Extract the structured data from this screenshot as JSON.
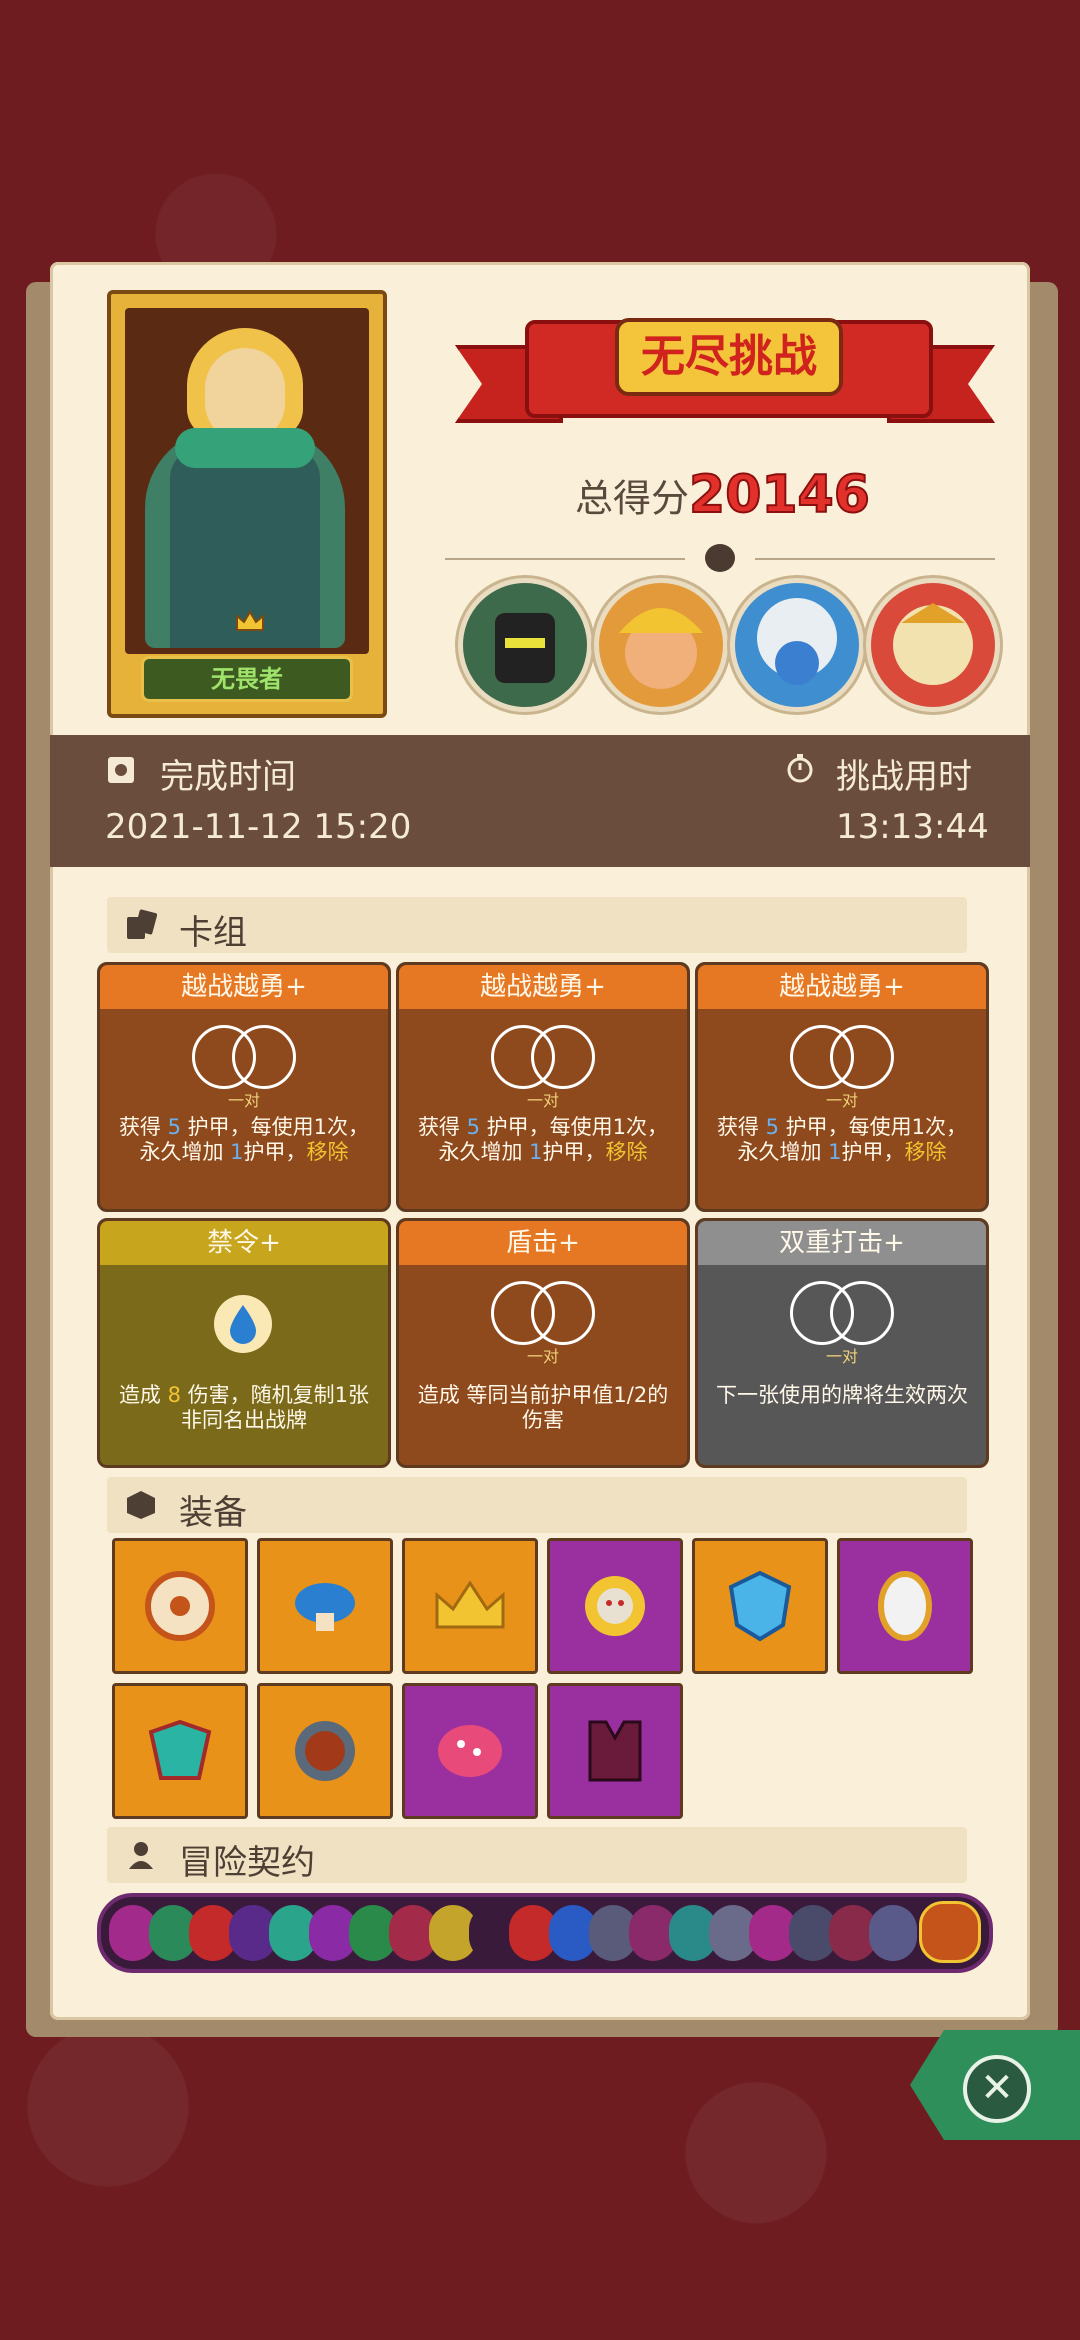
{
  "title_banner": "无尽挑战",
  "score": {
    "label": "总得分",
    "value": "20146"
  },
  "hero": {
    "name": "无畏者"
  },
  "bosses": [
    "boss-1",
    "boss-2",
    "boss-3",
    "boss-4"
  ],
  "times": {
    "complete_label": "完成时间",
    "complete_value": "2021-11-12 15:20",
    "duration_label": "挑战用时",
    "duration_value": "13:13:44"
  },
  "sections": {
    "deck": "卡组",
    "equipment": "装备",
    "contract": "冒险契约"
  },
  "cards": [
    {
      "title": "越战越勇+",
      "pair": "一对",
      "desc1": "获得 ",
      "num": "5",
      "desc2": " 护甲，每使用1次，永久增加 ",
      "num2": "1",
      "desc3": "护甲，",
      "remove": "移除"
    },
    {
      "title": "越战越勇+",
      "pair": "一对",
      "desc1": "获得 ",
      "num": "5",
      "desc2": " 护甲，每使用1次，永久增加 ",
      "num2": "1",
      "desc3": "护甲，",
      "remove": "移除"
    },
    {
      "title": "越战越勇+",
      "pair": "一对",
      "desc1": "获得 ",
      "num": "5",
      "desc2": " 护甲，每使用1次，永久增加 ",
      "num2": "1",
      "desc3": "护甲，",
      "remove": "移除"
    },
    {
      "title": "禁令+",
      "desc": "造成 ",
      "num": "8",
      "desc_b": " 伤害，随机复制1张非同名出战牌"
    },
    {
      "title": "盾击+",
      "pair": "一对",
      "desc": "造成 等同当前",
      "desc_b": "护甲值1/2的伤害"
    },
    {
      "title": "双重打击+",
      "pair": "一对",
      "desc": "下一张使用的牌将生效两次"
    }
  ],
  "colors": {
    "accent_red": "#e2302a",
    "board": "#faf0d9",
    "band": "#6a4d3c"
  },
  "close_icon": "close-icon"
}
